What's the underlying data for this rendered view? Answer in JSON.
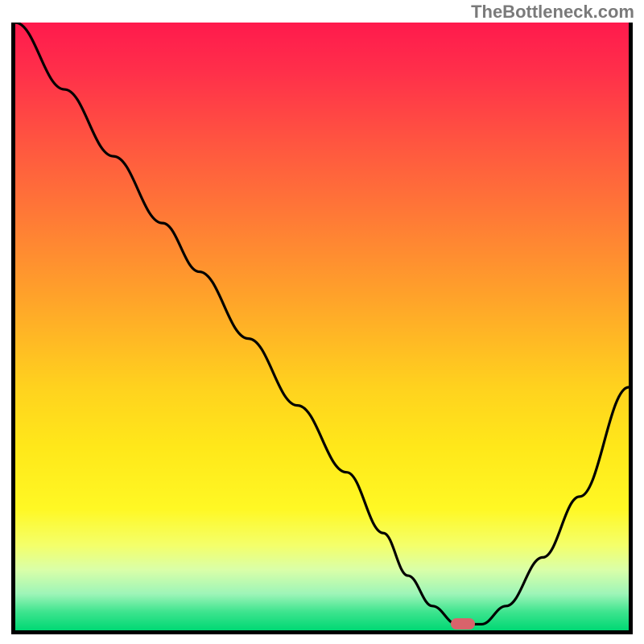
{
  "watermark": "TheBottleneck.com",
  "chart_data": {
    "type": "line",
    "title": "",
    "xlabel": "",
    "ylabel": "",
    "xlim": [
      0,
      100
    ],
    "ylim": [
      0,
      100
    ],
    "x": [
      0,
      8,
      16,
      24,
      30,
      38,
      46,
      54,
      60,
      64,
      68,
      72,
      76,
      80,
      86,
      92,
      100
    ],
    "values": [
      100,
      89,
      78,
      67,
      59,
      48,
      37,
      26,
      16,
      9,
      4,
      1,
      1,
      4,
      12,
      22,
      40
    ],
    "gradient_stops": [
      {
        "pct": 0,
        "color": "#ff1a4d"
      },
      {
        "pct": 20,
        "color": "#ff5640"
      },
      {
        "pct": 45,
        "color": "#ffa22a"
      },
      {
        "pct": 70,
        "color": "#ffe81a"
      },
      {
        "pct": 90,
        "color": "#daffa8"
      },
      {
        "pct": 100,
        "color": "#00d874"
      }
    ],
    "marker": {
      "x": 73,
      "y": 1,
      "color": "#d9636b"
    }
  }
}
